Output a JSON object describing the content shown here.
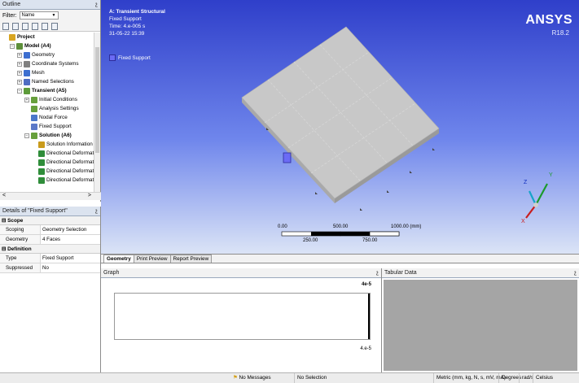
{
  "outline": {
    "title": "Outline",
    "pin": "չ",
    "filter_label": "Filter:",
    "filter_value": "Name",
    "tree": [
      {
        "label": "Project",
        "bold": true,
        "level": 0,
        "expander": "",
        "icon": "project-icon",
        "color": "#d8a520"
      },
      {
        "label": "Model (A4)",
        "bold": true,
        "level": 1,
        "expander": "−",
        "icon": "model-icon",
        "color": "#5d8f3a"
      },
      {
        "label": "Geometry",
        "bold": false,
        "level": 2,
        "expander": "+",
        "icon": "geometry-icon",
        "color": "#3d6fd0"
      },
      {
        "label": "Coordinate Systems",
        "bold": false,
        "level": 2,
        "expander": "+",
        "icon": "coordinate-systems-icon",
        "color": "#808080"
      },
      {
        "label": "Mesh",
        "bold": false,
        "level": 2,
        "expander": "+",
        "icon": "mesh-icon",
        "color": "#3d6fd0"
      },
      {
        "label": "Named Selections",
        "bold": false,
        "level": 2,
        "expander": "+",
        "icon": "named-selections-icon",
        "color": "#4f6dc2"
      },
      {
        "label": "Transient (A5)",
        "bold": true,
        "level": 2,
        "expander": "−",
        "icon": "transient-icon",
        "color": "#5d9b3a"
      },
      {
        "label": "Initial Conditions",
        "bold": false,
        "level": 3,
        "expander": "+",
        "icon": "initial-conditions-icon",
        "color": "#67a03c"
      },
      {
        "label": "Analysis Settings",
        "bold": false,
        "level": 3,
        "expander": "",
        "icon": "analysis-settings-icon",
        "color": "#67a03c"
      },
      {
        "label": "Nodal Force",
        "bold": false,
        "level": 3,
        "expander": "",
        "icon": "nodal-force-icon",
        "color": "#4a77c9"
      },
      {
        "label": "Fixed Support",
        "bold": false,
        "level": 3,
        "expander": "",
        "icon": "fixed-support-icon",
        "color": "#5b79c9"
      },
      {
        "label": "Solution (A6)",
        "bold": true,
        "level": 3,
        "expander": "−",
        "icon": "solution-icon",
        "color": "#67a03c"
      },
      {
        "label": "Solution Information",
        "bold": false,
        "level": 4,
        "expander": "",
        "icon": "solution-information-icon",
        "color": "#c99b1c"
      },
      {
        "label": "Directional Deformation",
        "bold": false,
        "level": 4,
        "expander": "",
        "icon": "directional-deformation-icon",
        "color": "#2f8d3a"
      },
      {
        "label": "Directional Deformation",
        "bold": false,
        "level": 4,
        "expander": "",
        "icon": "directional-deformation-icon",
        "color": "#2f8d3a"
      },
      {
        "label": "Directional Deformation",
        "bold": false,
        "level": 4,
        "expander": "",
        "icon": "directional-deformation-icon",
        "color": "#2f8d3a"
      },
      {
        "label": "Directional Deformation",
        "bold": false,
        "level": 4,
        "expander": "",
        "icon": "directional-deformation-icon",
        "color": "#2f8d3a"
      }
    ],
    "scroll_left": "<",
    "scroll_right": ">"
  },
  "details": {
    "title": "Details of \"Fixed Support\"",
    "pin": "չ",
    "sections": [
      {
        "title": "Scope",
        "rows": [
          {
            "key": "Scoping Method",
            "value": "Geometry Selection"
          },
          {
            "key": "Geometry",
            "value": "4 Faces"
          }
        ]
      },
      {
        "title": "Definition",
        "rows": [
          {
            "key": "Type",
            "value": "Fixed Support"
          },
          {
            "key": "Suppressed",
            "value": "No"
          }
        ]
      }
    ]
  },
  "viewport": {
    "title_line1": "A: Transient Structural",
    "title_line2": "Fixed Support",
    "title_line3": "Time: 4.e-005 s",
    "title_line4": "31-05-22 15:39",
    "legend_label": "Fixed Support",
    "legend_color": "#6b6bf5",
    "brand": "ANSYS",
    "version": "R18.2",
    "scale_top": [
      "0.00",
      "500.00",
      "1000.00 (mm)"
    ],
    "scale_bottom": [
      "250.00",
      "750.00"
    ],
    "triad": {
      "x": "X",
      "y": "Y",
      "z": "Z"
    }
  },
  "tabs": [
    {
      "label": "Geometry",
      "active": true
    },
    {
      "label": "Print Preview",
      "active": false
    },
    {
      "label": "Report Preview",
      "active": false
    }
  ],
  "graph": {
    "title": "Graph",
    "pin": "չ",
    "top_value": "4e-5",
    "bottom_value": "4.e-5"
  },
  "tabular": {
    "title": "Tabular Data",
    "pin": "չ"
  },
  "status": {
    "messages": "No Messages",
    "selection": "No Selection",
    "units": "Metric (mm, kg, N, s, mV, mA)",
    "angle": "Degrees",
    "rot": "rad/s",
    "temp": "Celsius"
  }
}
